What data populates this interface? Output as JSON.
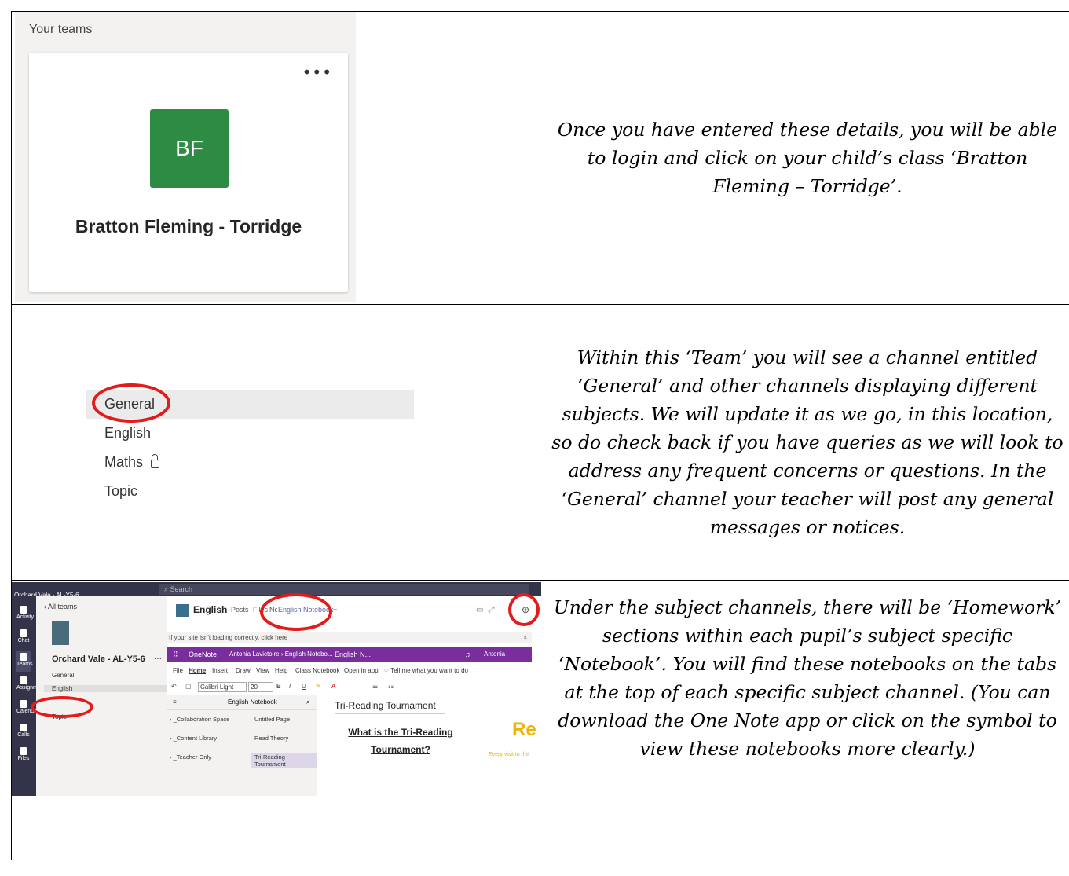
{
  "row1": {
    "teams_header": "Your teams",
    "team_card": {
      "more_icon": "more-icon",
      "initials": "BF",
      "avatar_color": "#2e8b44",
      "name": "Bratton Fleming - Torridge"
    },
    "instruction": "Once you have entered these details, you will be able to login and click on your child’s class ‘Bratton Fleming – Torridge’."
  },
  "row2": {
    "channels": [
      {
        "label": "General"
      },
      {
        "label": "English"
      },
      {
        "label": "Maths"
      },
      {
        "label": "Topic"
      }
    ],
    "highlight_color": "#e31b1b",
    "instruction": "Within this ‘Team’ you will see a channel entitled ‘General’ and other channels displaying different subjects. We will update it as we go, in this location, so do check back if you have queries as we will look to address any frequent concerns or questions. In the ‘General’ channel your teacher will post any general messages or notices."
  },
  "row3": {
    "shot": {
      "search": "Search",
      "org": "Orchard Vale - AL-Y5-6",
      "rail": [
        "Activity",
        "Chat",
        "Teams",
        "Assignments",
        "Calendar",
        "Calls",
        "Files"
      ],
      "back": "All teams",
      "team_name": "Orchard Vale - AL-Y5-6",
      "channels": [
        "General",
        "English",
        "Topic"
      ],
      "channel_title": "English",
      "tabs": [
        "Posts",
        "Files",
        "Notes",
        "English Notebook"
      ],
      "banner": "If your site isn't loading correctly, click here",
      "onenote": {
        "app": "OneNote",
        "crumb": "Antonia Lavictoire › English Notebo...",
        "doc": "English N...",
        "user": "Antonia Lavictoire"
      },
      "ribbon": [
        "File",
        "Home",
        "Insert",
        "Draw",
        "View",
        "Help",
        "Class Notebook",
        "Open in app",
        "Tell me what you want to do"
      ],
      "font": "Calibri Light",
      "size": "20",
      "notebook": "English Notebook",
      "sections": [
        "_Collaboration Space",
        "_Content Library",
        "_Teacher Only"
      ],
      "pages": [
        "Untitled Page",
        "Read Theory",
        "Tri-Reading Tournament"
      ],
      "page_title": "Tri-Reading Tournament",
      "page_heading": "What is the Tri-Reading Tournament?",
      "side_big": "Re",
      "side_small": "Every visit to the"
    },
    "instruction": "Under the subject channels, there will be ‘Homework’ sections within each pupil’s subject specific ‘Notebook’. You will find these notebooks on the tabs at the top of each specific subject channel. (You can download the One Note app or click on the symbol to view these notebooks more clearly.)"
  }
}
